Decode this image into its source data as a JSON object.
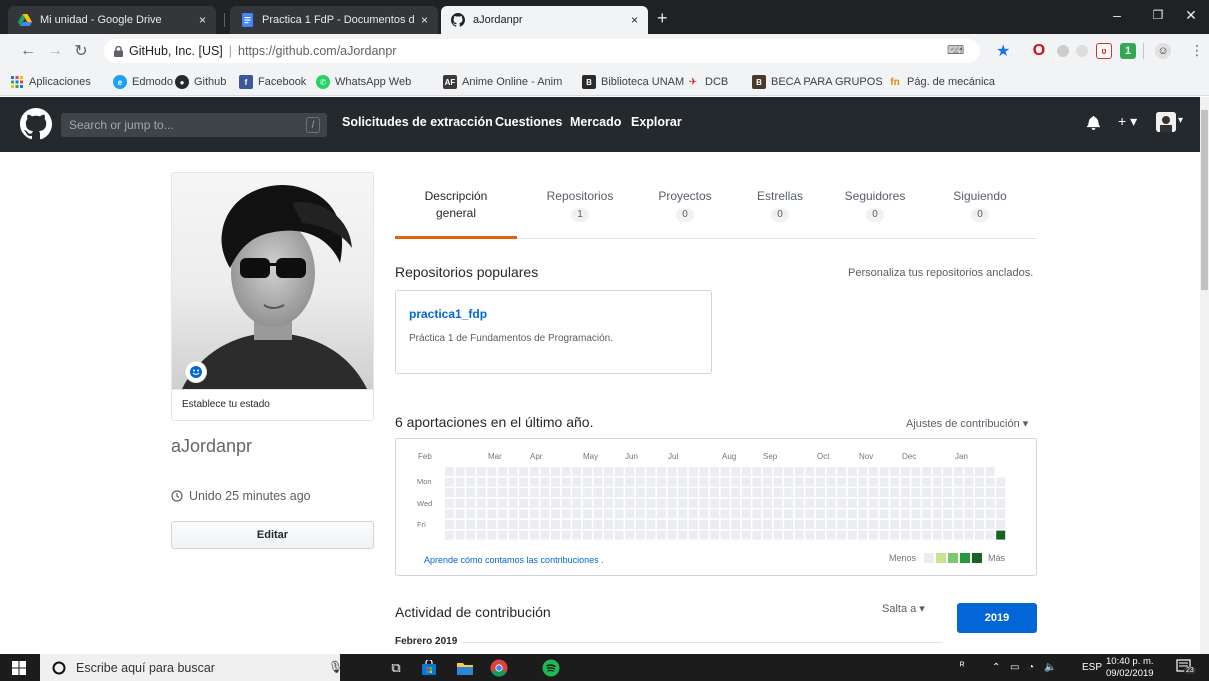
{
  "browser": {
    "tabs": [
      {
        "title": "Mi unidad - Google Drive",
        "icon": "google-drive-icon"
      },
      {
        "title": "Practica 1 FdP - Documentos de",
        "icon": "google-docs-icon"
      },
      {
        "title": "aJordanpr",
        "icon": "github-icon"
      }
    ],
    "new_tab": "+",
    "close_glyph": "×",
    "address": {
      "host_label": "GitHub, Inc. [US]",
      "separator": "|",
      "url_prefix": "https://github.com/",
      "url_path": "aJordanpr"
    },
    "bookmarks": [
      {
        "label": "Aplicaciones",
        "icon": "apps-grid-icon"
      },
      {
        "label": "Edmodo",
        "icon": "edmodo-icon"
      },
      {
        "label": "Github",
        "icon": "github-icon"
      },
      {
        "label": "Facebook",
        "icon": "facebook-icon"
      },
      {
        "label": "WhatsApp Web",
        "icon": "whatsapp-icon"
      },
      {
        "label": "Anime Online - Anim",
        "icon": "anime-icon"
      },
      {
        "label": "Biblioteca UNAM",
        "icon": "biblioteca-icon"
      },
      {
        "label": "DCB",
        "icon": "dcb-icon"
      },
      {
        "label": "BECA PARA GRUPOS",
        "icon": "beca-icon"
      },
      {
        "label": "Pág. de mecánica",
        "icon": "mecanica-icon"
      }
    ]
  },
  "github": {
    "search_placeholder": "Search or jump to...",
    "search_key": "/",
    "nav": [
      "Solicitudes de extracción",
      "Cuestiones",
      "Mercado",
      "Explorar"
    ],
    "header_glyphs": {
      "new": "+ ▾",
      "avatar_caret": "▾"
    }
  },
  "profile": {
    "status": "Establece tu estado",
    "username": "aJordanpr",
    "joined": "Unido 25 minutes ago",
    "edit": "Editar"
  },
  "tabs": [
    {
      "line1": "Descripción",
      "line2": "general",
      "count": null
    },
    {
      "line1": "Repositorios",
      "count": "1"
    },
    {
      "line1": "Proyectos",
      "count": "0"
    },
    {
      "line1": "Estrellas",
      "count": "0"
    },
    {
      "line1": "Seguidores",
      "count": "0"
    },
    {
      "line1": "Siguiendo",
      "count": "0"
    }
  ],
  "popular": {
    "heading": "Repositorios populares",
    "customize": "Personaliza tus repositorios anclados.",
    "repo_name": "practica1_fdp",
    "repo_desc": "Práctica 1 de Fundamentos de Programación."
  },
  "contributions": {
    "heading": "6 aportaciones en el último año.",
    "settings": "Ajustes de contribución ▾",
    "months": [
      "Feb",
      "Mar",
      "Apr",
      "May",
      "Jun",
      "Jul",
      "Aug",
      "Sep",
      "Oct",
      "Nov",
      "Dec",
      "Jan"
    ],
    "days": [
      "Mon",
      "Wed",
      "Fri"
    ],
    "learn": "Aprende cómo contamos las contribuciones .",
    "less": "Menos",
    "more": "Más",
    "legend_colors": [
      "#ebedf0",
      "#c6e48b",
      "#7bc96f",
      "#239a3b",
      "#196127"
    ],
    "weeks": 53,
    "active_cell": {
      "week": 52,
      "day": 6,
      "level": 4
    }
  },
  "activity": {
    "heading": "Actividad de contribución",
    "jump": "Salta a ▾",
    "year": "2019",
    "month": "Febrero 2019"
  },
  "taskbar": {
    "search": "Escribe aquí para buscar",
    "lang": "ESP",
    "time": "10:40 p. m.",
    "date": "09/02/2019",
    "notifications": "23"
  }
}
